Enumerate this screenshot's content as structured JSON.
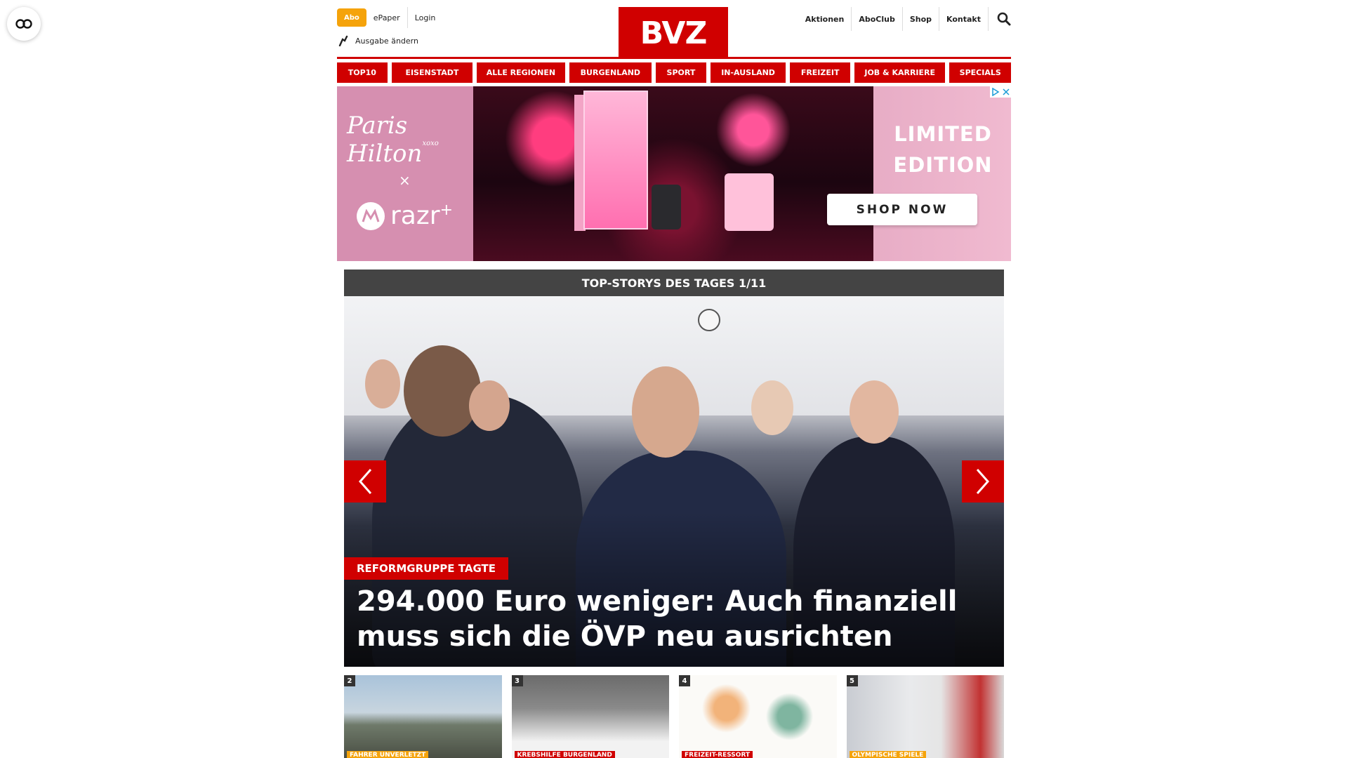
{
  "accessibility": {
    "icon": "accessibility-icon"
  },
  "header": {
    "abo_label": "Abo",
    "epaper_label": "ePaper",
    "login_label": "Login",
    "edition_label": "Ausgabe ändern",
    "logo_text": "BVZ",
    "right_links": [
      "Aktionen",
      "AboClub",
      "Shop",
      "Kontakt"
    ]
  },
  "nav": {
    "items": [
      "TOP10",
      "EISENSTADT",
      "ALLE REGIONEN",
      "BURGENLAND",
      "SPORT",
      "IN-AUSLAND",
      "FREIZEIT",
      "JOB & KARRIERE",
      "SPECIALS"
    ]
  },
  "ad": {
    "brand_text": "Paris Hilton",
    "brand_sup": "xoxo",
    "x_text": "×",
    "moto_text": "razr",
    "moto_sup": "+",
    "headline": "LIMITED EDITION",
    "cta": "SHOP NOW"
  },
  "top_stories": {
    "bar_title": "TOP-STORYS DES TAGES 1/11",
    "hero": {
      "tag": "REFORMGRUPPE TAGTE",
      "headline": "294.000 Euro weniger: Auch finanziell muss sich die ÖVP neu ausrichten"
    },
    "thumbs": [
      {
        "num": "2",
        "tag": "FAHRER UNVERLETZT",
        "tag_color": "#f5a30b"
      },
      {
        "num": "3",
        "tag": "KREBSHILFE BURGENLAND",
        "tag_color": "#d00000"
      },
      {
        "num": "4",
        "tag": "FREIZEIT-RESSORT",
        "tag_color": "#d00000"
      },
      {
        "num": "5",
        "tag": "OLYMPISCHE SPIELE",
        "tag_color": "#f5a30b"
      }
    ]
  },
  "colors": {
    "brand_red": "#d00000",
    "abo_orange": "#f5a30b",
    "bar_grey": "#444444"
  }
}
